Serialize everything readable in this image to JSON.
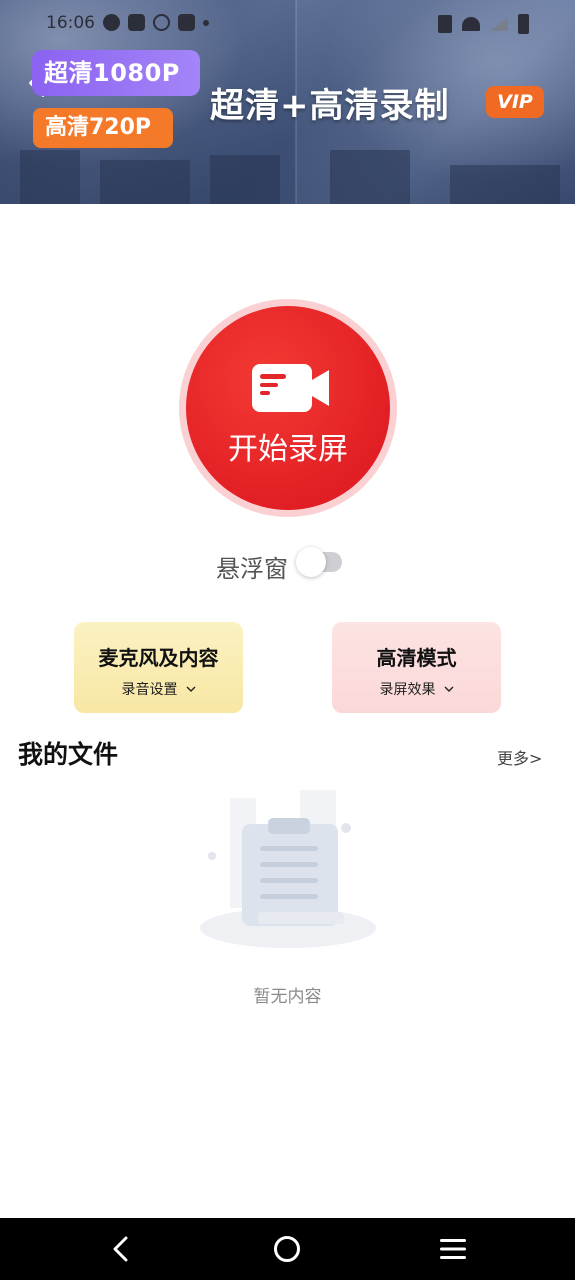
{
  "status_bar": {
    "time": "16:06"
  },
  "banner": {
    "badge_1080": "超清1080P",
    "badge_720": "高清720P",
    "title": "超清+高清录制",
    "vip": "VIP"
  },
  "record": {
    "label": "开始录屏"
  },
  "floating_window": {
    "label": "悬浮窗",
    "enabled": false
  },
  "cards": [
    {
      "title": "麦克风及内容",
      "subtitle": "录音设置"
    },
    {
      "title": "高清模式",
      "subtitle": "录屏效果"
    }
  ],
  "files": {
    "title": "我的文件",
    "more": "更多>",
    "empty_text": "暂无内容"
  },
  "colors": {
    "record_red": "#e21f24",
    "accent_purple": "#8b62f2",
    "accent_orange": "#f47a2a"
  }
}
